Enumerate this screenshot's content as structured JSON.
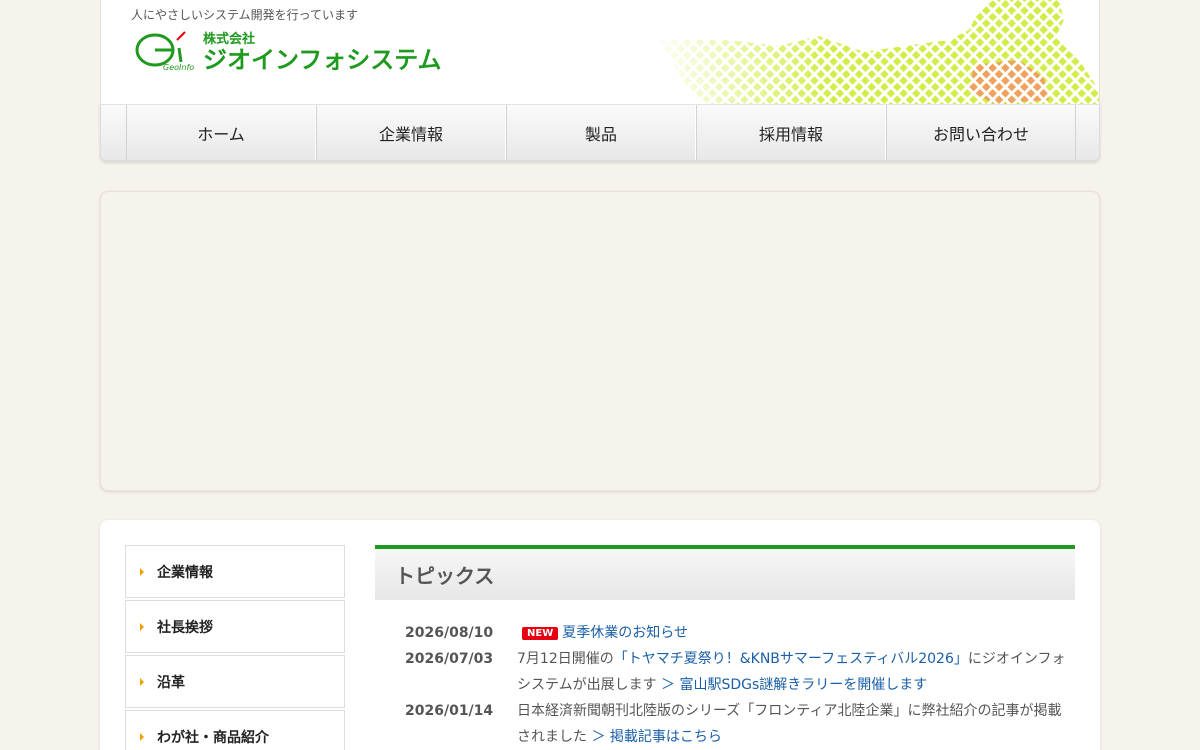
{
  "header": {
    "tagline": "人にやさしいシステム開発を行っています",
    "company_prefix": "株式会社",
    "company_name": "ジオインフォシステム",
    "logo_mark_text": "GeoInfo"
  },
  "nav": {
    "items": [
      {
        "label": "ホーム"
      },
      {
        "label": "企業情報"
      },
      {
        "label": "製品"
      },
      {
        "label": "採用情報"
      },
      {
        "label": "お問い合わせ"
      }
    ]
  },
  "sidebar": {
    "items": [
      {
        "label": "企業情報"
      },
      {
        "label": "社長挨拶"
      },
      {
        "label": "沿革"
      },
      {
        "label": "わが社・商品紹介"
      }
    ]
  },
  "topics": {
    "title": "トピックス",
    "items": [
      {
        "date": "2026/08/10",
        "badge": "NEW",
        "link": "夏季休業のお知らせ"
      },
      {
        "date": "2026/07/03",
        "text_before": "7月12日開催の",
        "link_inline": "「トヤマチ夏祭り！&KNBサマーフェスティバル2026」",
        "text_after": "にジオインフォシステムが出展します",
        "link_more": "＞ 富山駅SDGs謎解きラリーを開催します"
      },
      {
        "date": "2026/01/14",
        "text": "日本経済新聞朝刊北陸版のシリーズ「フロンティア北陸企業」に弊社紹介の記事が掲載されました",
        "link_more": "＞ 掲載記事はこちら"
      }
    ]
  },
  "colors": {
    "accent_green": "#1e9a1e",
    "link_blue": "#1a5fa8",
    "badge_red": "#e60012",
    "arrow_orange": "#f0a000",
    "page_bg": "#f6f3ec"
  }
}
